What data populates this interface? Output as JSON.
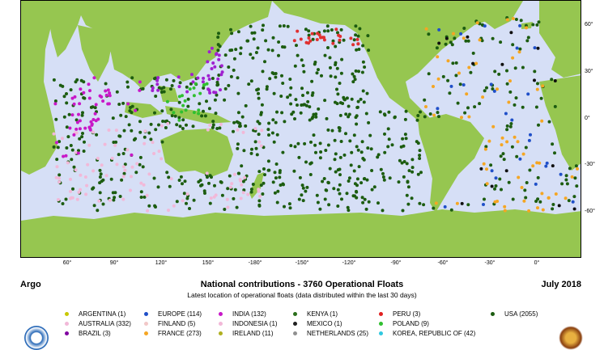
{
  "map": {
    "ocean_color": "#d6dff6",
    "land_color": "#96c650",
    "lat_labels": [
      "60°",
      "30°",
      "0°",
      "-30°",
      "-60°"
    ],
    "lon_labels": [
      "60°",
      "90°",
      "120°",
      "150°",
      "-180°",
      "-150°",
      "-120°",
      "-90°",
      "-60°",
      "-30°",
      "0°"
    ]
  },
  "caption": {
    "left": "Argo",
    "center": "National contributions -  3760 Operational Floats",
    "right": "July 2018",
    "subtitle": "Latest location of operational floats (data distributed within the last 30 days)"
  },
  "legend": [
    {
      "label": "ARGENTINA (1)",
      "color": "#c8c800"
    },
    {
      "label": "AUSTRALIA (332)",
      "color": "#f2b8d8"
    },
    {
      "label": "BRAZIL (3)",
      "color": "#8000a0"
    },
    {
      "label": "EUROPE (114)",
      "color": "#1f4fc8"
    },
    {
      "label": "FINLAND (5)",
      "color": "#f2c8c8"
    },
    {
      "label": "FRANCE (273)",
      "color": "#f5a623"
    },
    {
      "label": "INDIA (132)",
      "color": "#c818c8"
    },
    {
      "label": "INDONESIA (1)",
      "color": "#f2b8d8"
    },
    {
      "label": "IRELAND (11)",
      "color": "#b0b020"
    },
    {
      "label": "KENYA (1)",
      "color": "#2a6e1a"
    },
    {
      "label": "MEXICO (1)",
      "color": "#202020"
    },
    {
      "label": "NETHERLANDS (25)",
      "color": "#909090"
    },
    {
      "label": "PERU (3)",
      "color": "#e02020"
    },
    {
      "label": "POLAND (9)",
      "color": "#30c030"
    },
    {
      "label": "KOREA, REPUBLIC OF (42)",
      "color": "#30c8e0"
    },
    {
      "label": "USA (2055)",
      "color": "#1c5c10"
    }
  ],
  "float_colors": {
    "usa": "#1c5c10",
    "france": "#f5a623",
    "australia": "#f2b8d8",
    "europe": "#1f4fc8",
    "japan_korea": "#30c8e0",
    "india": "#c818c8",
    "china": "#a020d0",
    "uk": "#f09820",
    "germany": "#101010",
    "canada": "#e03030",
    "poland": "#30c030"
  }
}
